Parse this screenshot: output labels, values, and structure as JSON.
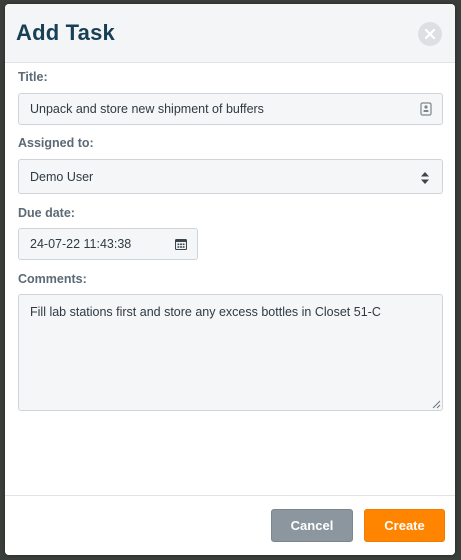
{
  "dialog": {
    "title": "Add Task"
  },
  "form": {
    "title_label": "Title:",
    "title_value": "Unpack and store new shipment of buffers",
    "assigned_label": "Assigned to:",
    "assigned_value": "Demo User",
    "due_label": "Due date:",
    "due_value": "24-07-22 11:43:38",
    "comments_label": "Comments:",
    "comments_value": "Fill lab stations first and store any excess bottles in Closet 51-C"
  },
  "footer": {
    "cancel_label": "Cancel",
    "create_label": "Create"
  },
  "colors": {
    "title_text": "#173f55",
    "create_button": "#ff8400",
    "cancel_button": "#8b969e"
  },
  "icons": {
    "close": "close-icon",
    "title_field": "contact-card-icon",
    "select": "sort-arrows-icon",
    "date": "calendar-icon"
  }
}
